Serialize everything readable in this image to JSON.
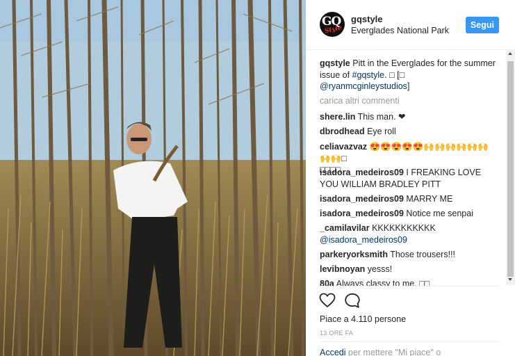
{
  "post": {
    "username": "gqstyle",
    "location": "Everglades National Park",
    "follow_label": "Segui",
    "avatar_text": "GQ",
    "avatar_sub": "Style"
  },
  "caption": {
    "user": "gqstyle",
    "text": "Pitt in the Everglades for the summer issue of ",
    "hashtag": "#gqstyle",
    "suffix": ". □ [□",
    "mention": "@ryanmcginleystudios",
    "mention_suffix": "]"
  },
  "load_more": "carica altri commenti",
  "comments": [
    {
      "user": "shere.lin",
      "text": "This man. ❤"
    },
    {
      "user": "dbrodhead",
      "text": "Eye roll"
    },
    {
      "user": "celiavazvaz",
      "text": "😍😍😍😍😍🙌🙌🙌🙌🙌🙌🙌🙌□",
      "text2": "□□□□"
    },
    {
      "user": "isadora_medeiros09",
      "text": "I FREAKING LOVE",
      "text2": "YOU WILLIAM BRADLEY PITT"
    },
    {
      "user": "isadora_medeiros09",
      "text": "MARRY ME"
    },
    {
      "user": "isadora_medeiros09",
      "text": "Notice me senpai"
    },
    {
      "user": "_camilavilar",
      "text": "KKKKKKKKKKK",
      "mention2": "@isadora_medeiros09"
    },
    {
      "user": "parkeryorksmith",
      "text": "Those trousers!!!"
    },
    {
      "user": "levibnoyan",
      "text": "yesss!"
    },
    {
      "user": "80a",
      "text": "Always classy to me. □□"
    }
  ],
  "actions": {
    "like_icon": "heart-icon",
    "comment_icon": "comment-bubble-icon"
  },
  "likes_text": "Piace a 4.110 persone",
  "time_text": "13 ORE FA",
  "login": {
    "link": "Accedi",
    "rest": " per mettere \"Mi piace\" o"
  }
}
